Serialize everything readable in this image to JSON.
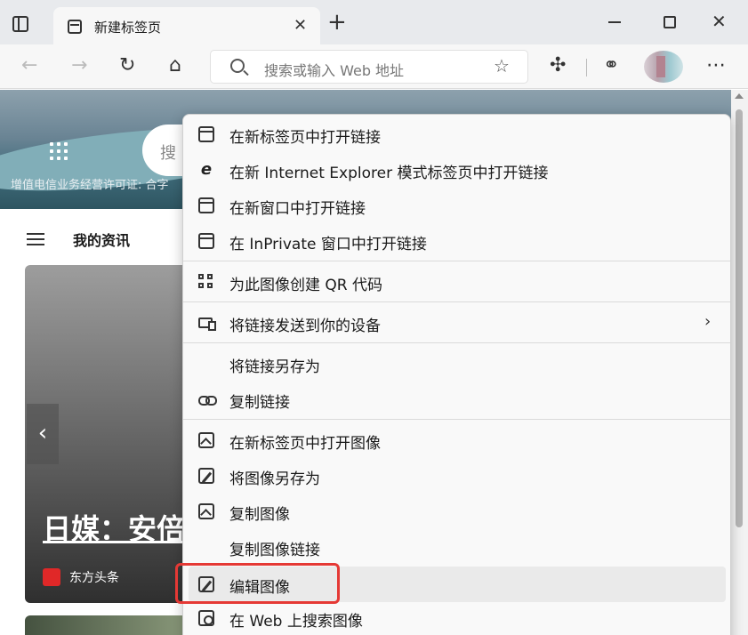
{
  "browser": {
    "tab": {
      "title": "新建标签页",
      "close_glyph": "✕"
    },
    "new_tab_glyph": "+",
    "window_controls": {
      "close_glyph": "✕"
    },
    "address_bar": {
      "placeholder": "搜索或输入 Web 地址"
    }
  },
  "page": {
    "search_partial": "搜",
    "license_text": "增值电信业务经营许可证: 合字",
    "news_section_label": "我的资讯",
    "card": {
      "headline": "日媒：安倍",
      "source": "东方头条",
      "prev_glyph": "‹"
    }
  },
  "context_menu": {
    "items": [
      {
        "label": "在新标签页中打开链接",
        "icon": "new-tab-icon"
      },
      {
        "label": "在新 Internet Explorer 模式标签页中打开链接",
        "icon": "ie-icon"
      },
      {
        "label": "在新窗口中打开链接",
        "icon": "window-icon"
      },
      {
        "label": "在 InPrivate 窗口中打开链接",
        "icon": "inprivate-icon"
      },
      {
        "label": "为此图像创建 QR 代码",
        "icon": "qr-code-icon"
      },
      {
        "label": "将链接发送到你的设备",
        "icon": "send-to-device-icon",
        "submenu_glyph": "›"
      },
      {
        "label": "将链接另存为",
        "icon": ""
      },
      {
        "label": "复制链接",
        "icon": "link-icon"
      },
      {
        "label": "在新标签页中打开图像",
        "icon": "open-image-icon"
      },
      {
        "label": "将图像另存为",
        "icon": "save-image-icon"
      },
      {
        "label": "复制图像",
        "icon": "image-icon"
      },
      {
        "label": "复制图像链接",
        "icon": ""
      },
      {
        "label": "编辑图像",
        "icon": "edit-image-icon",
        "highlighted": true
      },
      {
        "label": "在 Web 上搜索图像",
        "icon": "search-image-icon"
      }
    ]
  },
  "colors": {
    "annotation_box": "#e53935",
    "menu_hover": "#eaeaea"
  }
}
